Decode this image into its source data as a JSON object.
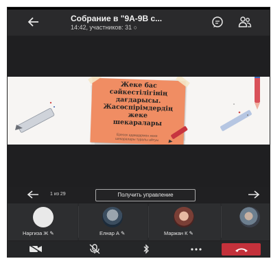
{
  "header": {
    "title": "Собрание в \"9А-9В с...",
    "subtitle": "14:42, участников: 31 ○"
  },
  "slide": {
    "lines": [
      "Жеке бас",
      "сәйкестілігінің",
      "дағдарысы.",
      "Жасөспірімдердің",
      "жеке",
      "шекаралары"
    ],
    "footer_lines": [
      "Ересек адамдармен жеке",
      "шекаралары туралы айтуы"
    ]
  },
  "nav": {
    "page_count": "1 из 29",
    "control_label": "Получить управление"
  },
  "participants": [
    {
      "name": "Наргиза Ж ✎"
    },
    {
      "name": "Елнар А ✎"
    },
    {
      "name": "Маржан К ✎"
    }
  ],
  "colors": {
    "background": "#202022",
    "accent_hangup": "#c4313b",
    "slide_card": "#f08d63"
  }
}
